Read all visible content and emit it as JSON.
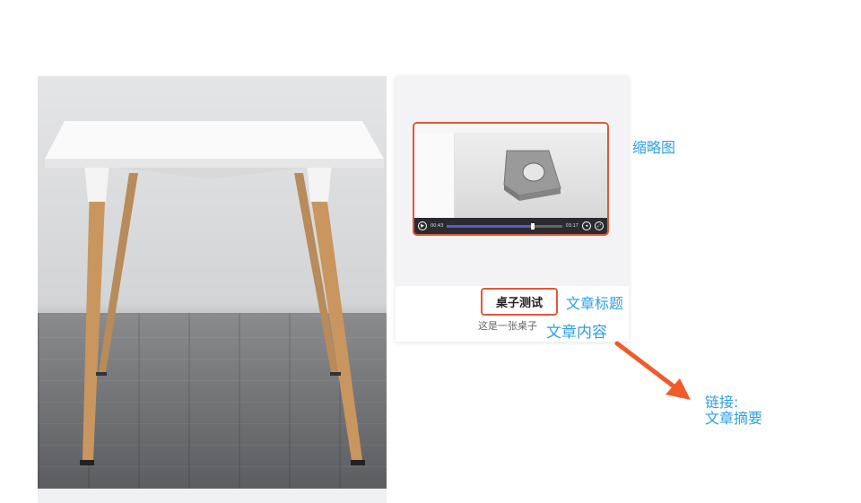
{
  "card": {
    "title": "桌子测试",
    "summary": "这是一张桌子",
    "video_player": {
      "current_time": "00:43",
      "total_time": "03:17",
      "progress": 0.74
    }
  },
  "annotations": {
    "thumbnail": "缩略图",
    "title": "文章标题",
    "content": "文章内容",
    "link_label": "链接:",
    "link_target": "文章摘要"
  },
  "colors": {
    "highlight_border": "#e2573a",
    "annotation_text": "#2e9fe3",
    "arrow": "#f25a2a"
  }
}
